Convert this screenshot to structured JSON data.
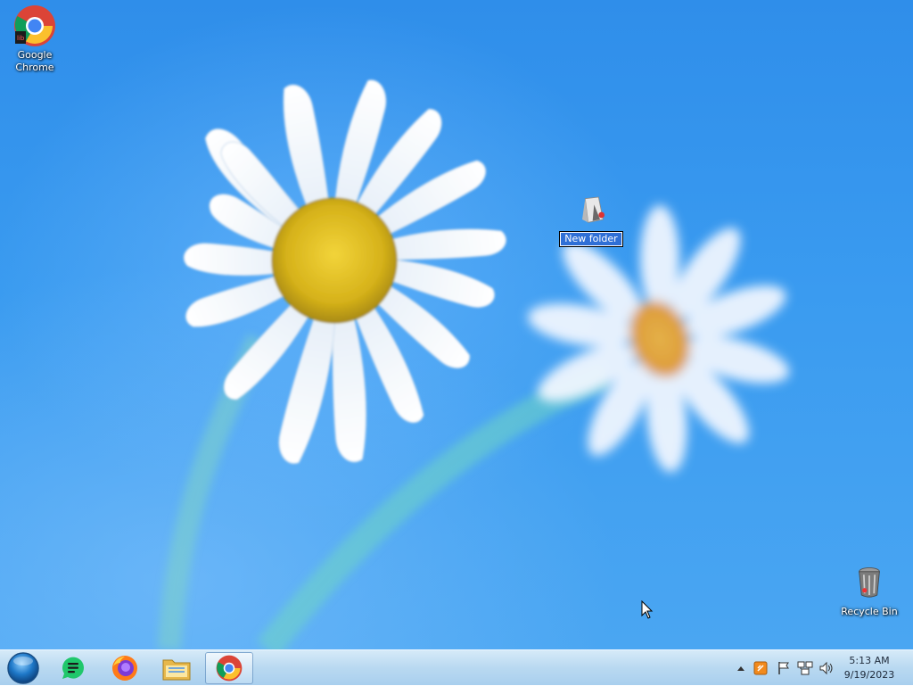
{
  "desktop": {
    "icons": [
      {
        "name": "google-chrome-shortcut",
        "label": "Google\nChrome"
      },
      {
        "name": "new-folder",
        "label": "New folder",
        "editing": true
      },
      {
        "name": "recycle-bin",
        "label": "Recycle Bin"
      }
    ]
  },
  "taskbar": {
    "start_button": "start-orb-icon",
    "pinned": [
      {
        "name": "sheets-app",
        "icon": "green-document-icon"
      },
      {
        "name": "firefox",
        "icon": "firefox-icon"
      },
      {
        "name": "file-explorer",
        "icon": "folder-icon"
      },
      {
        "name": "google-chrome",
        "icon": "chrome-icon",
        "active": true
      }
    ],
    "tray": {
      "icons": [
        "show-hidden-icons-chevron",
        "app-tray-icon",
        "action-center-flag-icon",
        "network-icon",
        "volume-icon"
      ],
      "time": "5:13 AM",
      "date": "9/19/2023"
    }
  },
  "colors": {
    "desktop_blue": "#3a9bf0",
    "taskbar": "#b9d9f1",
    "selection": "#2f6fd6"
  }
}
